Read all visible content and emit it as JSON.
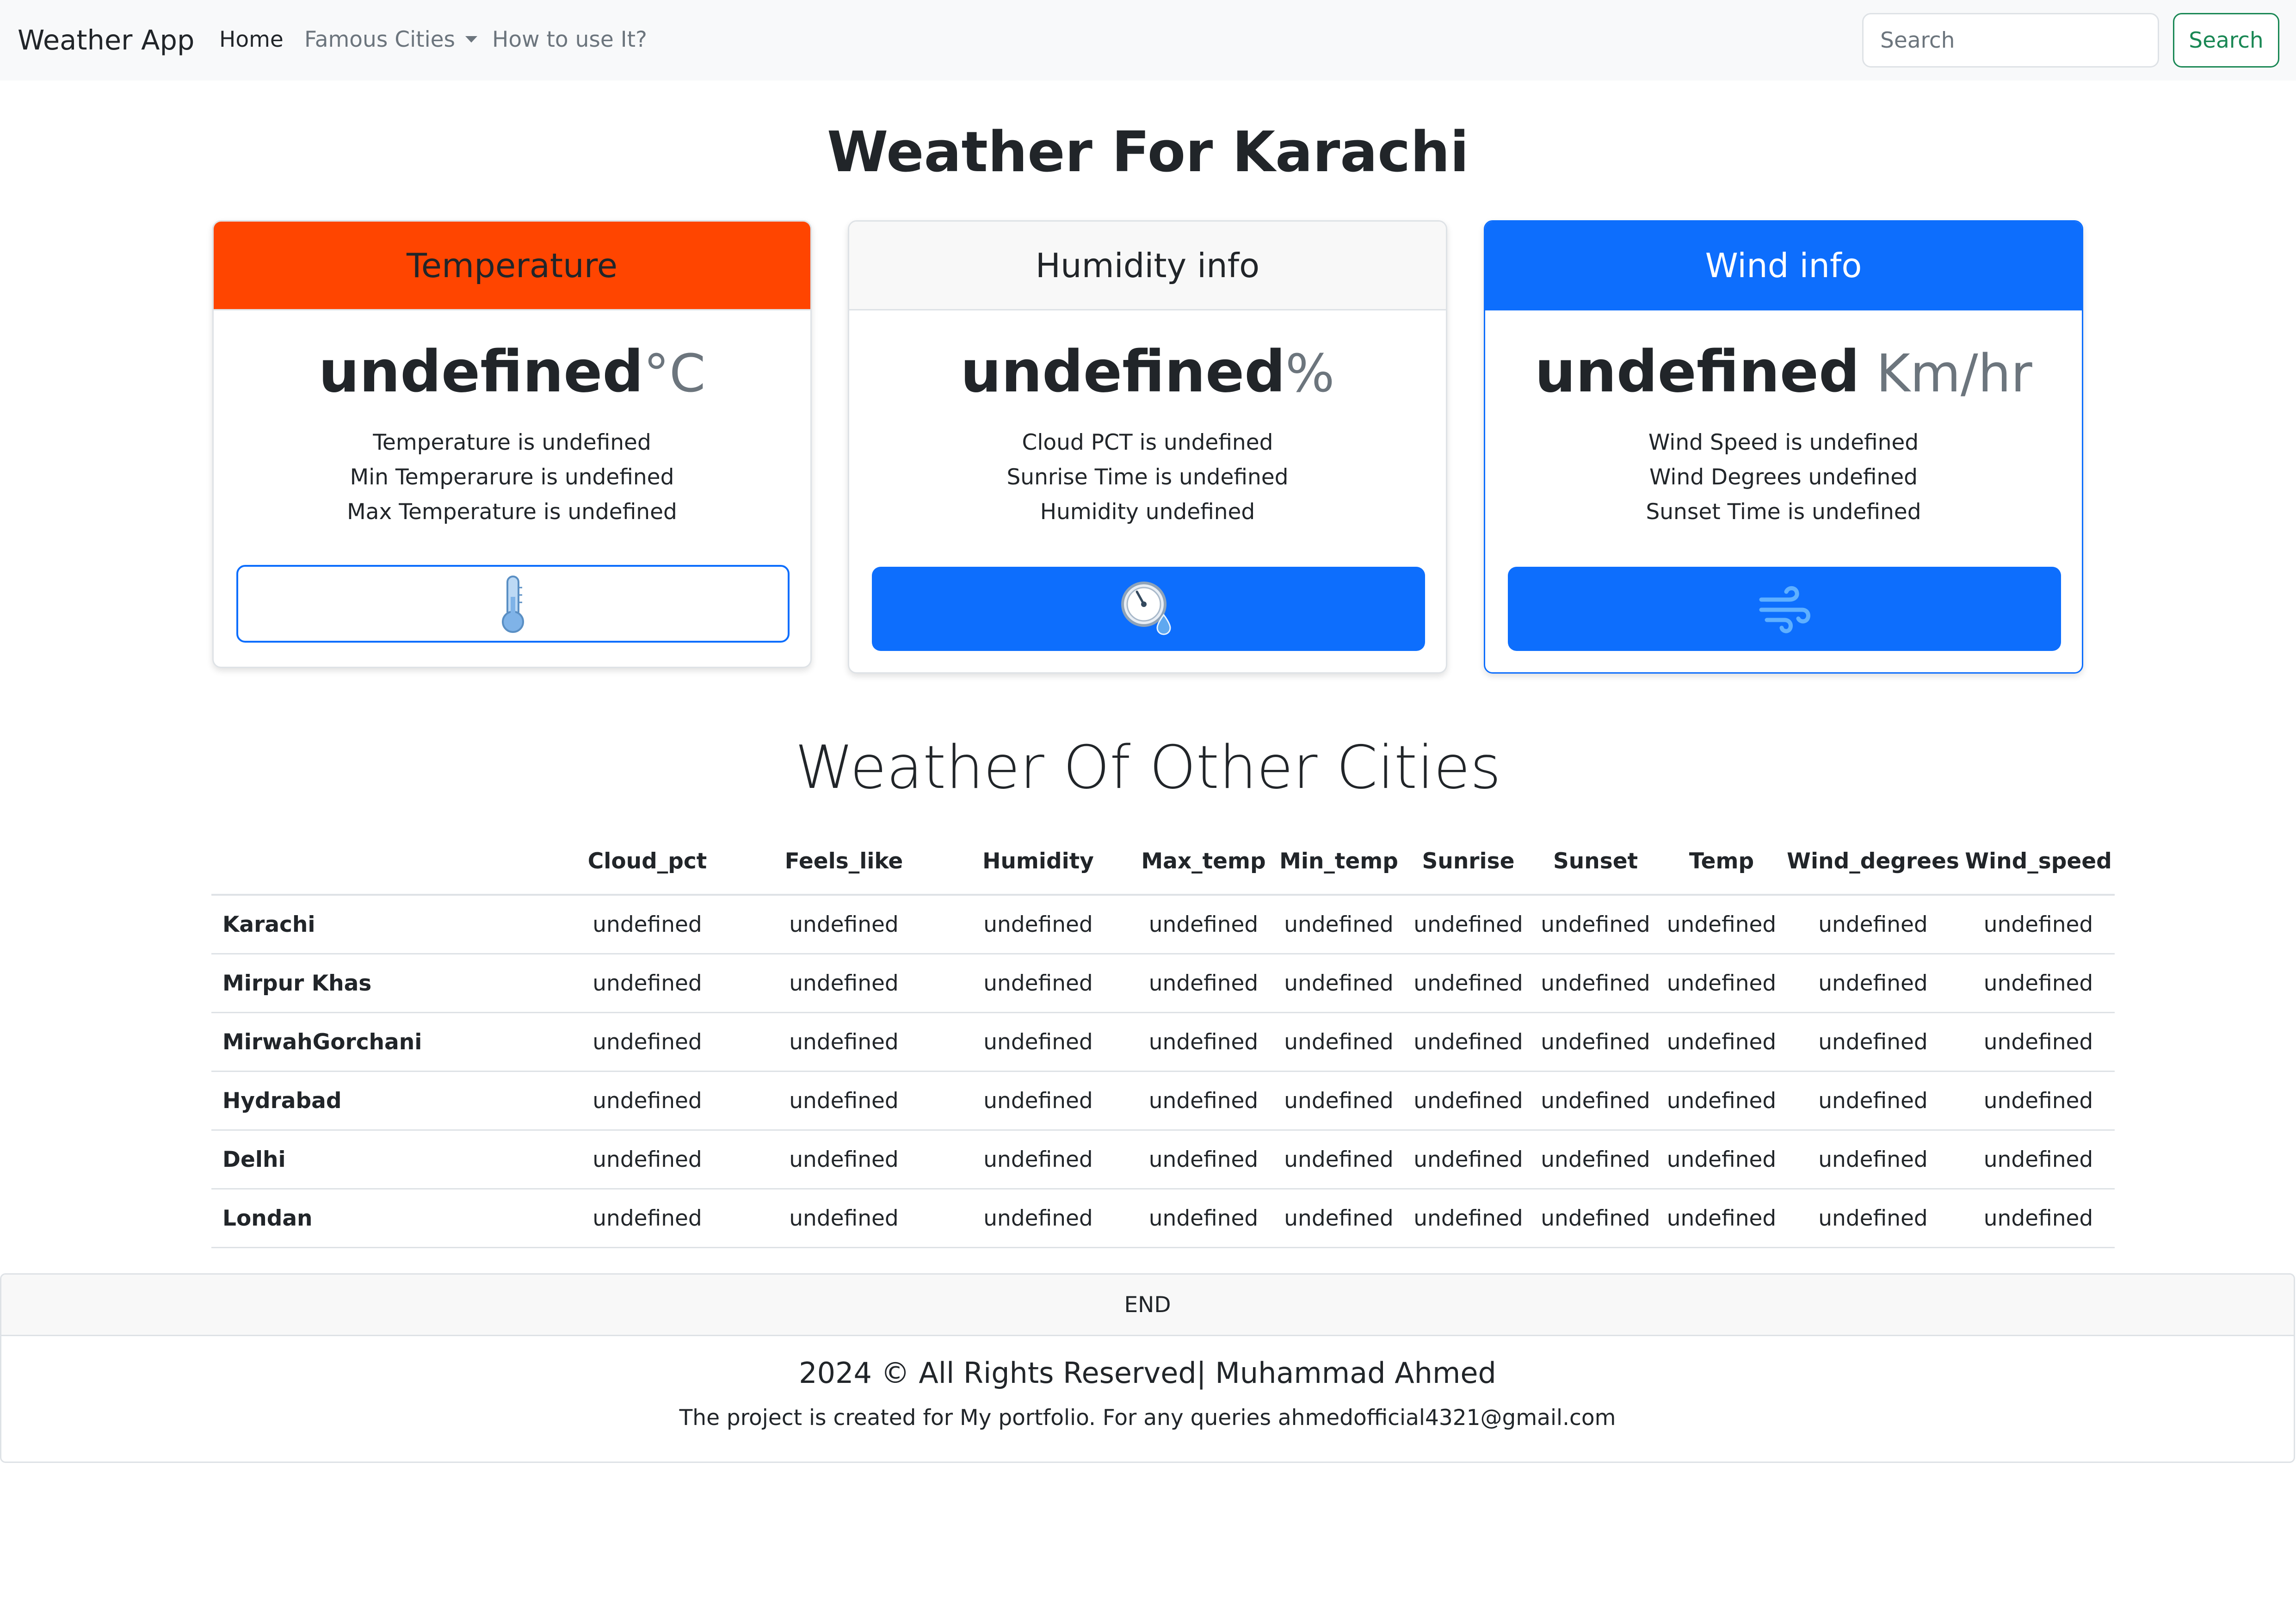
{
  "navbar": {
    "brand": "Weather App",
    "links": [
      "Home",
      "Famous Cities",
      "How to use It?"
    ],
    "search_placeholder": "Search",
    "search_button": "Search"
  },
  "page_title": "Weather For Karachi",
  "cards": {
    "temperature": {
      "header": "Temperature",
      "value": "undefined",
      "unit": "°C",
      "lines": [
        "Temperature is undefined",
        "Min Temperarure is undefined",
        "Max Temperature is undefined"
      ],
      "icon": "thermometer-icon"
    },
    "humidity": {
      "header": "Humidity info",
      "value": "undefined",
      "unit": "%",
      "lines": [
        "Cloud PCT is undefined",
        "Sunrise Time is undefined",
        "Humidity undefined"
      ],
      "icon": "humidity-gauge-icon"
    },
    "wind": {
      "header": "Wind info",
      "value": "undefined",
      "unit": " Km/hr",
      "lines": [
        "Wind Speed is undefined",
        "Wind Degrees undefined",
        "Sunset Time is undefined"
      ],
      "icon": "wind-icon"
    }
  },
  "other_cities": {
    "title": "Weather Of Other Cities",
    "columns": [
      "",
      "Cloud_pct",
      "Feels_like",
      "Humidity",
      "Max_temp",
      "Min_temp",
      "Sunrise",
      "Sunset",
      "Temp",
      "Wind_degrees",
      "Wind_speed"
    ],
    "rows": [
      [
        "Karachi",
        "undefined",
        "undefined",
        "undefined",
        "undefined",
        "undefined",
        "undefined",
        "undefined",
        "undefined",
        "undefined",
        "undefined"
      ],
      [
        "Mirpur Khas",
        "undefined",
        "undefined",
        "undefined",
        "undefined",
        "undefined",
        "undefined",
        "undefined",
        "undefined",
        "undefined",
        "undefined"
      ],
      [
        "MirwahGorchani",
        "undefined",
        "undefined",
        "undefined",
        "undefined",
        "undefined",
        "undefined",
        "undefined",
        "undefined",
        "undefined",
        "undefined"
      ],
      [
        "Hydrabad",
        "undefined",
        "undefined",
        "undefined",
        "undefined",
        "undefined",
        "undefined",
        "undefined",
        "undefined",
        "undefined",
        "undefined"
      ],
      [
        "Delhi",
        "undefined",
        "undefined",
        "undefined",
        "undefined",
        "undefined",
        "undefined",
        "undefined",
        "undefined",
        "undefined",
        "undefined"
      ],
      [
        "Londan",
        "undefined",
        "undefined",
        "undefined",
        "undefined",
        "undefined",
        "undefined",
        "undefined",
        "undefined",
        "undefined",
        "undefined"
      ]
    ]
  },
  "footer": {
    "header": "END",
    "title": "2024 © All Rights Reserved| Muhammad Ahmed",
    "text": "The project is created for My portfolio. For any queries ahmedofficial4321@gmail.com"
  },
  "colors": {
    "temperature_header": "#ff4500",
    "primary": "#0d6efd",
    "success": "#198754",
    "navbar_bg": "#f8f9fa"
  }
}
